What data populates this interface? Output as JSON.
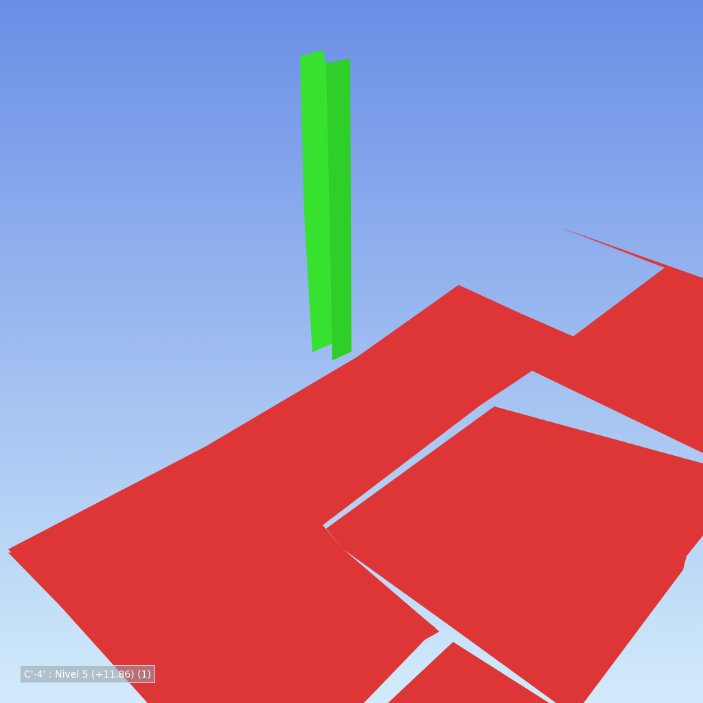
{
  "viewport": {
    "status_label": "C'-4' : Nivel 5 (+11.86) (1)"
  },
  "colors": {
    "sky_top": "#6a8ee6",
    "sky_bottom": "#d2ebfb",
    "slab": "#de3636",
    "column": "#38e02f",
    "column_shadow": "#2fcf29"
  }
}
